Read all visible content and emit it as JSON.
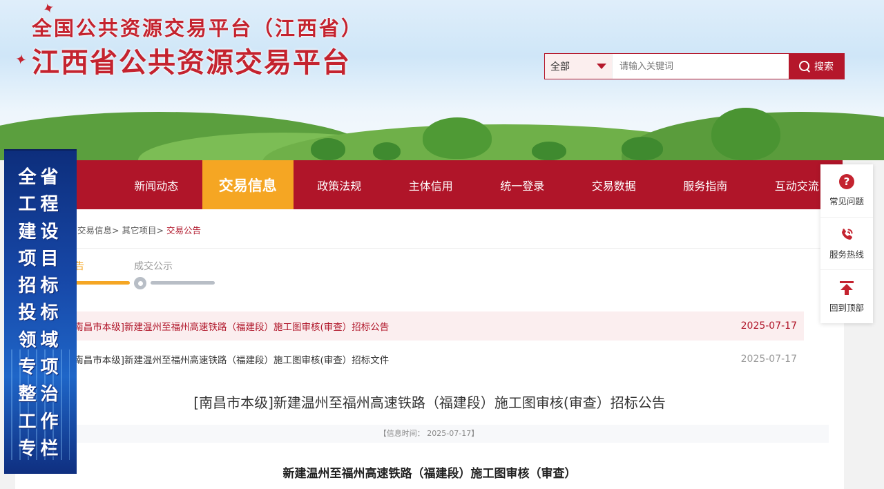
{
  "header": {
    "title_line1": "全国公共资源交易平台（江西省）",
    "title_line2": "江西省公共资源交易平台"
  },
  "search": {
    "scope": "全部",
    "placeholder": "请输入关键词",
    "button": "搜索"
  },
  "nav": {
    "items": [
      {
        "label": "新闻动态"
      },
      {
        "label": "交易信息"
      },
      {
        "label": "政策法规"
      },
      {
        "label": "主体信用"
      },
      {
        "label": "统一登录"
      },
      {
        "label": "交易数据"
      },
      {
        "label": "服务指南"
      },
      {
        "label": "互动交流"
      }
    ]
  },
  "breadcrumb": {
    "items": [
      "交易信息>",
      "其它项目>"
    ],
    "current": "交易公告"
  },
  "tabs": {
    "announcement": "告",
    "result": "成交公示"
  },
  "list": [
    {
      "title": "[南昌市本级]新建温州至福州高速铁路（福建段）施工图审核(审查）招标公告",
      "date": "2025-07-17"
    },
    {
      "title": "[南昌市本级]新建温州至福州高速铁路（福建段）施工图审核(审查）招标文件",
      "date": "2025-07-17"
    }
  ],
  "article": {
    "title": "[南昌市本级]新建温州至福州高速铁路（福建段）施工图审核(审查）招标公告",
    "info": "【信息时间：  2025-07-17】",
    "heading": "新建温州至福州高速铁路（福建段）施工图审核（审查）"
  },
  "left_banner": {
    "lines": [
      "全省",
      "工程",
      "建设",
      "项目",
      "招标",
      "投标",
      "领域",
      "专项",
      "整治",
      "工作",
      "专栏"
    ]
  },
  "right_tools": {
    "faq": "常见问题",
    "hotline": "服务热线",
    "top": "回到顶部"
  },
  "colors": {
    "brand_red": "#b01529",
    "accent_orange": "#f5a623"
  }
}
